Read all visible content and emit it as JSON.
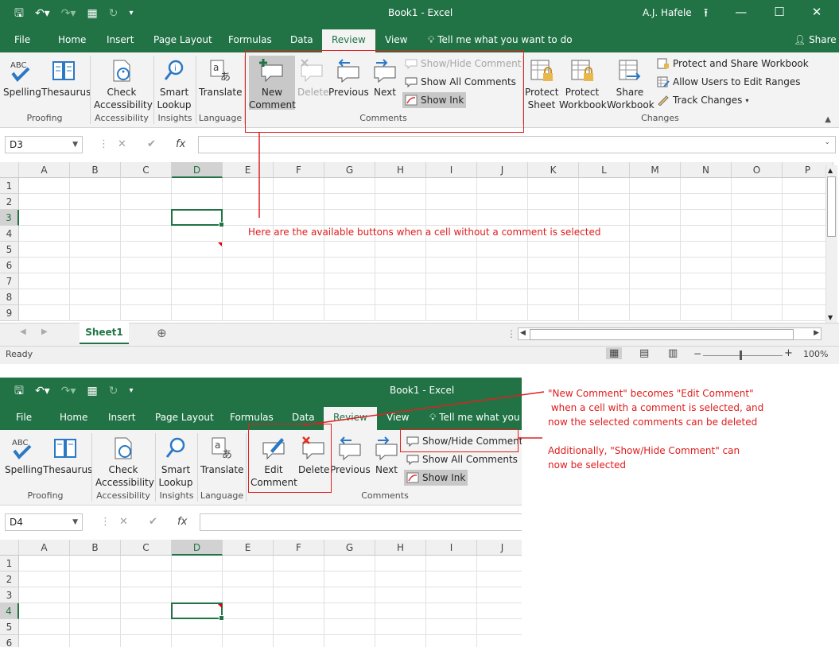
{
  "top_window": {
    "title": "Book1  -  Excel",
    "user": "A.J. Hafele",
    "share": "Share",
    "tell_me": "Tell me what you want to do",
    "tabs": [
      "File",
      "Home",
      "Insert",
      "Page Layout",
      "Formulas",
      "Data",
      "Review",
      "View"
    ],
    "active_tab": "Review",
    "ribbon": {
      "spelling": "Spelling",
      "thesaurus": "Thesaurus",
      "abc": "ABC",
      "check_accessibility": [
        "Check",
        "Accessibility"
      ],
      "smart_lookup": [
        "Smart",
        "Lookup"
      ],
      "translate": "Translate",
      "new_comment": [
        "New",
        "Comment"
      ],
      "delete": "Delete",
      "previous": "Previous",
      "next": "Next",
      "show_hide_comment": "Show/Hide Comment",
      "show_all_comments": "Show All Comments",
      "show_ink": "Show Ink",
      "protect_sheet": [
        "Protect",
        "Sheet"
      ],
      "protect_workbook": [
        "Protect",
        "Workbook"
      ],
      "share_workbook": [
        "Share",
        "Workbook"
      ],
      "protect_share_workbook": "Protect and Share Workbook",
      "allow_users": "Allow Users to Edit Ranges",
      "track_changes": "Track Changes",
      "groups": [
        "Proofing",
        "Accessibility",
        "Insights",
        "Language",
        "Comments",
        "Changes"
      ]
    },
    "name_box": "D3",
    "fx": "fx",
    "columns": [
      "A",
      "B",
      "C",
      "D",
      "E",
      "F",
      "G",
      "H",
      "I",
      "J",
      "K",
      "L",
      "M",
      "N",
      "O",
      "P"
    ],
    "rows": [
      "1",
      "2",
      "3",
      "4",
      "5",
      "6",
      "7",
      "8",
      "9"
    ],
    "sheet_tab": "Sheet1",
    "status": "Ready",
    "zoom": "100%"
  },
  "bottom_window": {
    "title": "Book1  -  Excel",
    "tell_me": "Tell me what you w",
    "tabs": [
      "File",
      "Home",
      "Insert",
      "Page Layout",
      "Formulas",
      "Data",
      "Review",
      "View"
    ],
    "ribbon": {
      "edit_comment": [
        "Edit",
        "Comment"
      ],
      "delete": "Delete",
      "previous": "Previous",
      "next": "Next",
      "show_hide_comment": "Show/Hide Comment",
      "show_all_comments": "Show All Comments",
      "show_ink": "Show Ink"
    },
    "name_box": "D4",
    "columns": [
      "A",
      "B",
      "C",
      "D",
      "E",
      "F",
      "G",
      "H",
      "I",
      "J"
    ],
    "rows": [
      "1",
      "2",
      "3",
      "4",
      "5",
      "6"
    ]
  },
  "annotations": {
    "top": "Here are the available buttons when a cell without a comment is selected",
    "bottom_1": "\"New Comment\" becomes \"Edit Comment\"\n when a cell with a comment is selected, and\nnow the selected comments can be deleted",
    "bottom_2": "Additionally, \"Show/Hide Comment\" can\nnow be selected"
  },
  "colors": {
    "excel_green": "#217346",
    "annotation_red": "#e01b1b"
  }
}
